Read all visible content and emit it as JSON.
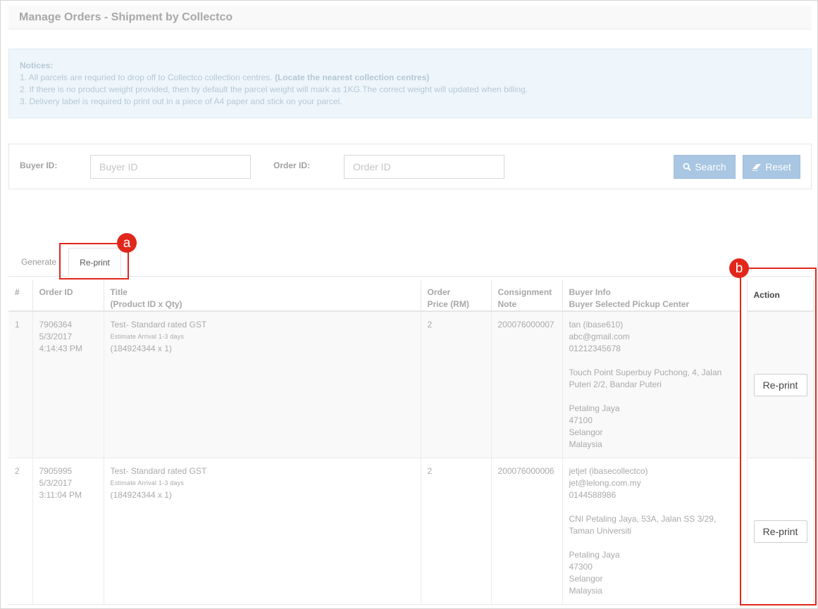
{
  "page": {
    "title": "Manage Orders - Shipment by Collectco"
  },
  "notices": {
    "heading": "Notices:",
    "line1_prefix": "1. All parcels are requried to drop off to Collectco collection centres.",
    "line1_link": "(Locate the nearest collection centres)",
    "line2": "2. If there is no product weight provided, then by default the parcel weight will mark as 1KG.The correct weight will updated when billing.",
    "line3": "3. Delivery label is required to print out in a piece of A4 paper and stick on your parcel."
  },
  "filter": {
    "buyer_label": "Buyer ID:",
    "buyer_placeholder": "Buyer ID",
    "order_label": "Order ID:",
    "order_placeholder": "Order ID",
    "search_label": "Search",
    "reset_label": "Reset"
  },
  "tabs": [
    {
      "label": "Generate"
    },
    {
      "label": "Re-print"
    }
  ],
  "annotations": {
    "a": "a",
    "b": "b",
    "color": "#e1271b"
  },
  "table": {
    "headers": {
      "num": "#",
      "order_id": "Order ID",
      "title_1": "Title",
      "title_2": "(Product ID x Qty)",
      "price_1": "Order",
      "price_2": "Price (RM)",
      "consign_1": "Consignment",
      "consign_2": "Note",
      "buyer_1": "Buyer Info",
      "buyer_2": "Buyer Selected Pickup Center",
      "action": "Action"
    },
    "rows": [
      {
        "num": "1",
        "order_id": "7906364",
        "date": "5/3/2017",
        "time": "4:14:43 PM",
        "title": "Test- Standard rated GST",
        "estimate": "Estimate Arrival 1-3 days",
        "product": "(184924344 x 1)",
        "price": "2",
        "consignment": "200076000007",
        "buyer_name": "tan (ibase610)",
        "buyer_email": "abc@gmail.com",
        "buyer_phone": "01212345678",
        "pickup_line1": "Touch Point Superbuy Puchong, 4, Jalan",
        "pickup_line2": "Puteri 2/2, Bandar Puteri",
        "city": "Petaling Jaya",
        "postcode": "47100",
        "state": "Selangor",
        "country": "Malaysia",
        "action_label": "Re-print"
      },
      {
        "num": "2",
        "order_id": "7905995",
        "date": "5/3/2017",
        "time": "3:11:04 PM",
        "title": "Test- Standard rated GST",
        "estimate": "Estimate Arrival 1-3 days",
        "product": "(184924344 x 1)",
        "price": "2",
        "consignment": "200076000006",
        "buyer_name": "jetjet (ibasecollectco)",
        "buyer_email": "jet@lelong.com.my",
        "buyer_phone": "0144588986",
        "pickup_line1": "CNI Petaling Jaya, 53A, Jalan SS 3/29,",
        "pickup_line2": "Taman Universiti",
        "city": "Petaling Jaya",
        "postcode": "47300",
        "state": "Selangor",
        "country": "Malaysia",
        "action_label": "Re-print"
      }
    ]
  }
}
